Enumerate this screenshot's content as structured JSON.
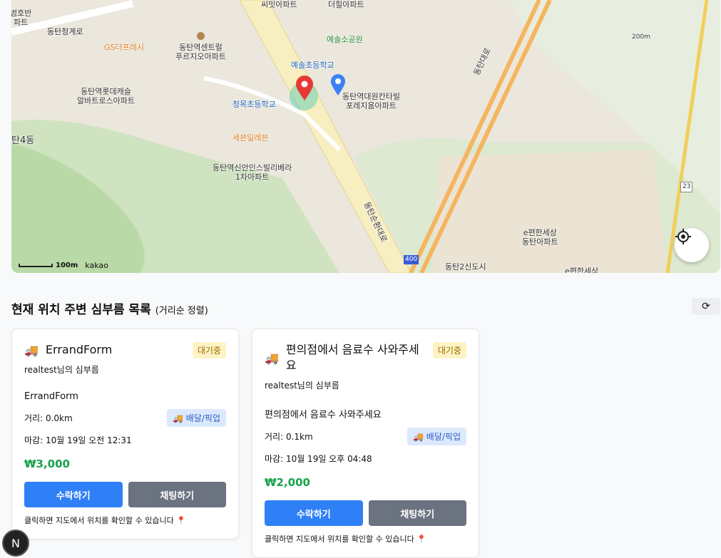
{
  "map": {
    "labels": [
      {
        "text": "범호반\n파트",
        "c": ""
      },
      {
        "text": "동탄청계로",
        "c": ""
      },
      {
        "text": "GS더프레시",
        "c": "o"
      },
      {
        "text": "동탄역센트럴\n푸르지오아파트",
        "c": ""
      },
      {
        "text": "씨밋아파트",
        "c": ""
      },
      {
        "text": "더힐아파트",
        "c": ""
      },
      {
        "text": "예솔소공원",
        "c": "g"
      },
      {
        "text": "예솔초등학교",
        "c": "b"
      },
      {
        "text": "동탄역롯데캐슬\n알바트로스아파트",
        "c": ""
      },
      {
        "text": "청목초등학교",
        "c": "b"
      },
      {
        "text": "동탄역대원칸타빌\n포레지움아파트",
        "c": ""
      },
      {
        "text": "탄4동",
        "c": ""
      },
      {
        "text": "세븐일레븐",
        "c": "o"
      },
      {
        "text": "동탄역신안인스빌리베라\n1차아파트",
        "c": ""
      },
      {
        "text": "동탄대로",
        "c": ""
      },
      {
        "text": "동탄순환대로",
        "c": ""
      },
      {
        "text": "200m",
        "c": ""
      },
      {
        "text": "23",
        "c": ""
      },
      {
        "text": "400",
        "c": ""
      },
      {
        "text": "e편한세상\n동탄아파트",
        "c": ""
      },
      {
        "text": "동탄2신도시",
        "c": ""
      },
      {
        "text": "e편한세상",
        "c": ""
      }
    ],
    "scale": "100m",
    "brand": "kakao"
  },
  "list": {
    "title": "현재 위치 주변 심부름 목록",
    "sort": "(거리순 정렬)"
  },
  "cards": [
    {
      "title": "ErrandForm",
      "status": "대기중",
      "owner": "realtest님의 심부름",
      "desc": "ErrandForm",
      "distance": "거리: 0.0km",
      "category": "배달/픽업",
      "due": "마감: 10월 19일 오전 12:31",
      "price": "₩3,000",
      "accept": "수락하기",
      "chat": "채팅하기",
      "hint": "클릭하면 지도에서 위치를 확인할 수 있습니다 📍"
    },
    {
      "title": "편의점에서 음료수 사와주세요",
      "status": "대기중",
      "owner": "realtest님의 심부름",
      "desc": "편의점에서 음료수 사와주세요",
      "distance": "거리: 0.1km",
      "category": "배달/픽업",
      "due": "마감: 10월 19일 오후 04:48",
      "price": "₩2,000",
      "accept": "수락하기",
      "chat": "채팅하기",
      "hint": "클릭하면 지도에서 위치를 확인할 수 있습니다 📍"
    }
  ],
  "colors": {
    "accent": "#2f80f6",
    "price": "#16a34a"
  }
}
